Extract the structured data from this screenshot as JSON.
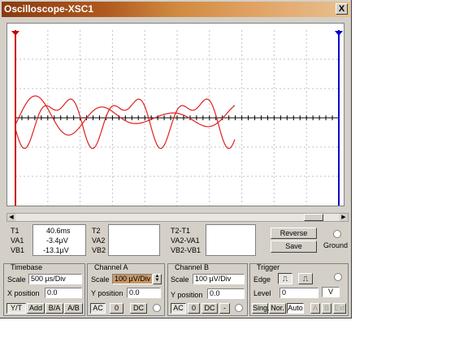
{
  "window": {
    "title": "Oscilloscope-XSC1",
    "close_label": "X"
  },
  "readout": {
    "t1": {
      "label": "T1",
      "value": "40.6ms"
    },
    "va1": {
      "label": "VA1",
      "value": "-3.4µV"
    },
    "vb1": {
      "label": "VB1",
      "value": "-13.1µV"
    },
    "t2": "T2",
    "va2": "VA2",
    "vb2": "VB2",
    "t2t1": "T2-T1",
    "va2va1": "VA2-VA1",
    "vb2vb1": "VB2-VB1"
  },
  "buttons": {
    "reverse": "Reverse",
    "save": "Save",
    "ground": "Ground"
  },
  "timebase": {
    "title": "Timebase",
    "scale_label": "Scale",
    "scale_value": "500 µs/Div",
    "xpos_label": "X position",
    "xpos_value": "0.0",
    "modes": [
      "Y/T",
      "Add",
      "B/A",
      "A/B"
    ]
  },
  "channel_a": {
    "title": "Channel A",
    "scale_label": "Scale",
    "scale_value": "100 µV/Div",
    "ypos_label": "Y position",
    "ypos_value": "0.0",
    "coupling": [
      "AC",
      "0",
      "DC"
    ]
  },
  "channel_b": {
    "title": "Channel B",
    "scale_label": "Scale",
    "scale_value": "100 µV/Div",
    "ypos_label": "Y position",
    "ypos_value": "0.0",
    "coupling": [
      "AC",
      "0",
      "DC",
      "-"
    ]
  },
  "trigger": {
    "title": "Trigger",
    "edge_label": "Edge",
    "level_label": "Level",
    "level_value": "0",
    "level_unit": "V",
    "modes": [
      "Sing.",
      "Nor.",
      "Auto"
    ],
    "sources": [
      "A",
      "B",
      "Ext"
    ]
  },
  "colors": {
    "trace_a": "#e02020",
    "cursor_1": "#cc0000",
    "cursor_2": "#0000cc"
  }
}
